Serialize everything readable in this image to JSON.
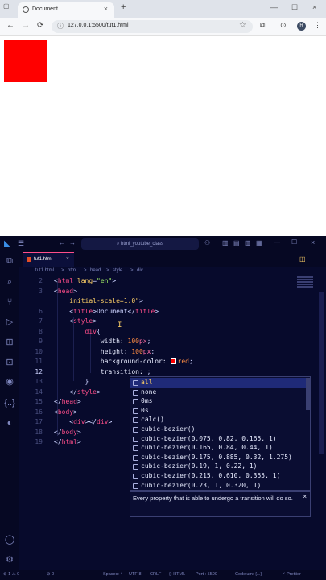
{
  "browser": {
    "tab_title": "Document",
    "tab_close": "×",
    "new_tab": "+",
    "window_controls": [
      "—",
      "☐",
      "×"
    ],
    "url": "127.0.0.1:5500/tut1.html",
    "nav": {
      "back": "←",
      "forward": "→",
      "reload": "⟳"
    },
    "avatar_initial": "R",
    "page_box_color": "#ff0000"
  },
  "vscode": {
    "search_text": "html_youtube_class",
    "file_tab": "tut1.html",
    "breadcrumbs": [
      "tut1.html",
      ">",
      "html",
      ">",
      "head",
      ">",
      "style",
      ">",
      "div"
    ],
    "code_lines": [
      {
        "n": "2",
        "parts": [
          {
            "c": "pt",
            "t": "<"
          },
          {
            "c": "tg",
            "t": "html"
          },
          {
            "c": "at",
            "t": " lang"
          },
          {
            "c": "pt",
            "t": "="
          },
          {
            "c": "st",
            "t": "\"en\""
          },
          {
            "c": "pt",
            "t": ">"
          }
        ]
      },
      {
        "n": "3",
        "parts": [
          {
            "c": "pt",
            "t": "<"
          },
          {
            "c": "tg",
            "t": "head"
          },
          {
            "c": "pt",
            "t": ">"
          }
        ]
      },
      {
        "n": "",
        "parts": [
          {
            "c": "at",
            "t": "    initial-scale=1.0\""
          },
          {
            "c": "pt",
            "t": ">"
          }
        ]
      },
      {
        "n": "6",
        "parts": [
          {
            "c": "pt",
            "t": "    <"
          },
          {
            "c": "tg",
            "t": "title"
          },
          {
            "c": "pt",
            "t": ">Document</"
          },
          {
            "c": "tg",
            "t": "title"
          },
          {
            "c": "pt",
            "t": ">"
          }
        ]
      },
      {
        "n": "7",
        "parts": [
          {
            "c": "pt",
            "t": "    <"
          },
          {
            "c": "tg",
            "t": "style"
          },
          {
            "c": "pt",
            "t": ">"
          }
        ]
      },
      {
        "n": "8",
        "parts": [
          {
            "c": "tg",
            "t": "        div"
          },
          {
            "c": "pt",
            "t": "{"
          }
        ]
      },
      {
        "n": "9",
        "parts": [
          {
            "c": "pr",
            "t": "            width: "
          },
          {
            "c": "nu",
            "t": "100"
          },
          {
            "c": "kw",
            "t": "px"
          },
          {
            "c": "pt",
            "t": ";"
          }
        ]
      },
      {
        "n": "10",
        "parts": [
          {
            "c": "pr",
            "t": "            height: "
          },
          {
            "c": "nu",
            "t": "100"
          },
          {
            "c": "kw",
            "t": "px"
          },
          {
            "c": "pt",
            "t": ";"
          }
        ]
      },
      {
        "n": "11",
        "swatch": true,
        "parts": [
          {
            "c": "pr",
            "t": "            background-color: "
          },
          {
            "c": "SW",
            "t": ""
          },
          {
            "c": "nu",
            "t": "red"
          },
          {
            "c": "pt",
            "t": ";"
          }
        ]
      },
      {
        "n": "12",
        "cur": true,
        "parts": [
          {
            "c": "pr",
            "t": "            transition: "
          },
          {
            "c": "pt",
            "t": ";"
          }
        ]
      },
      {
        "n": "13",
        "parts": [
          {
            "c": "pt",
            "t": "        }"
          }
        ]
      },
      {
        "n": "14",
        "parts": [
          {
            "c": "pt",
            "t": "    </"
          },
          {
            "c": "tg",
            "t": "style"
          },
          {
            "c": "pt",
            "t": ">"
          }
        ]
      },
      {
        "n": "15",
        "parts": [
          {
            "c": "pt",
            "t": "</"
          },
          {
            "c": "tg",
            "t": "head"
          },
          {
            "c": "pt",
            "t": ">"
          }
        ]
      },
      {
        "n": "16",
        "parts": [
          {
            "c": "pt",
            "t": "<"
          },
          {
            "c": "tg",
            "t": "body"
          },
          {
            "c": "pt",
            "t": ">"
          }
        ]
      },
      {
        "n": "17",
        "parts": [
          {
            "c": "pt",
            "t": "    <"
          },
          {
            "c": "tg",
            "t": "div"
          },
          {
            "c": "pt",
            "t": "></"
          },
          {
            "c": "tg",
            "t": "div"
          },
          {
            "c": "pt",
            "t": ">"
          }
        ]
      },
      {
        "n": "18",
        "parts": [
          {
            "c": "pt",
            "t": "</"
          },
          {
            "c": "tg",
            "t": "body"
          },
          {
            "c": "pt",
            "t": ">"
          }
        ]
      },
      {
        "n": "19",
        "parts": [
          {
            "c": "pt",
            "t": "</"
          },
          {
            "c": "tg",
            "t": "html"
          },
          {
            "c": "pt",
            "t": ">"
          }
        ]
      }
    ],
    "suggestions": [
      "all",
      "none",
      "0ms",
      "0s",
      "calc()",
      "cubic-bezier()",
      "cubic-bezier(0.075, 0.82, 0.165, 1)",
      "cubic-bezier(0.165, 0.84, 0.44, 1)",
      "cubic-bezier(0.175, 0.885, 0.32, 1.275)",
      "cubic-bezier(0.19, 1, 0.22, 1)",
      "cubic-bezier(0.215, 0.610, 0.355, 1)",
      "cubic-bezier(0.23, 1, 0.320, 1)"
    ],
    "suggest_doc": "Every property that is able to undergo a transition will do so.",
    "doc_close": "×",
    "status": {
      "errors": "⊗ 1 ⚠ 0",
      "warnings": "⊘ 0",
      "spaces": "Spaces: 4",
      "encoding": "UTF-8",
      "eol": "CRLF",
      "language": "{} HTML",
      "port": "Port : 5500",
      "codeium": "Codeium: {...}",
      "prettier": "✓ Prettier"
    }
  }
}
